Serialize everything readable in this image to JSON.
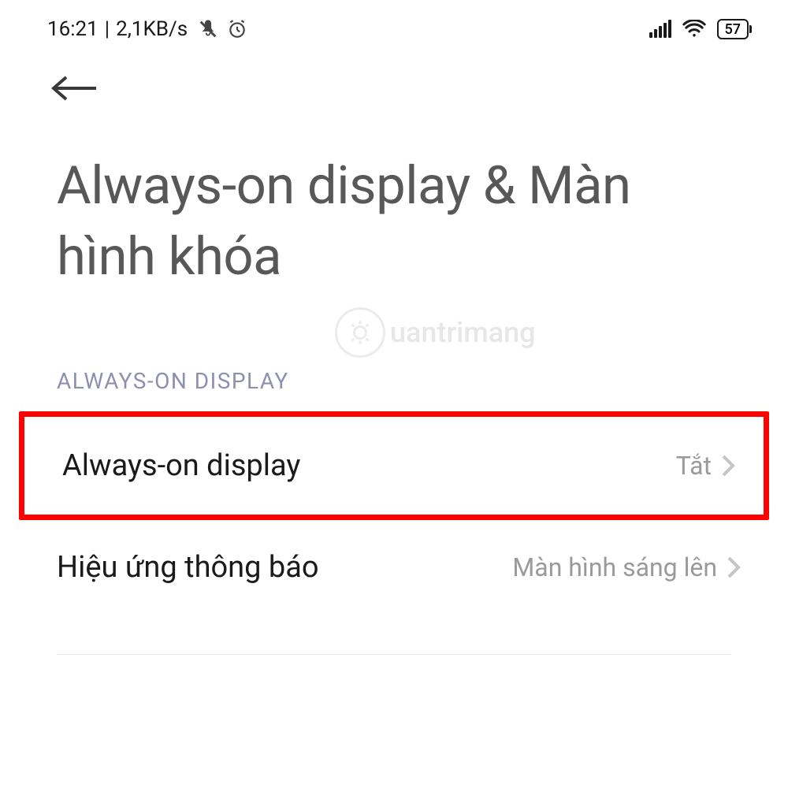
{
  "status_bar": {
    "time": "16:21",
    "separator": "|",
    "data_rate": "2,1KB/s",
    "battery_level": "57"
  },
  "page": {
    "title": "Always-on display & Màn hình khóa"
  },
  "watermark": {
    "text": "uantrimang"
  },
  "section": {
    "header": "ALWAYS-ON DISPLAY"
  },
  "settings": {
    "always_on": {
      "label": "Always-on display",
      "value": "Tắt"
    },
    "notification_effect": {
      "label": "Hiệu ứng thông báo",
      "value": "Màn hình sáng lên"
    }
  }
}
